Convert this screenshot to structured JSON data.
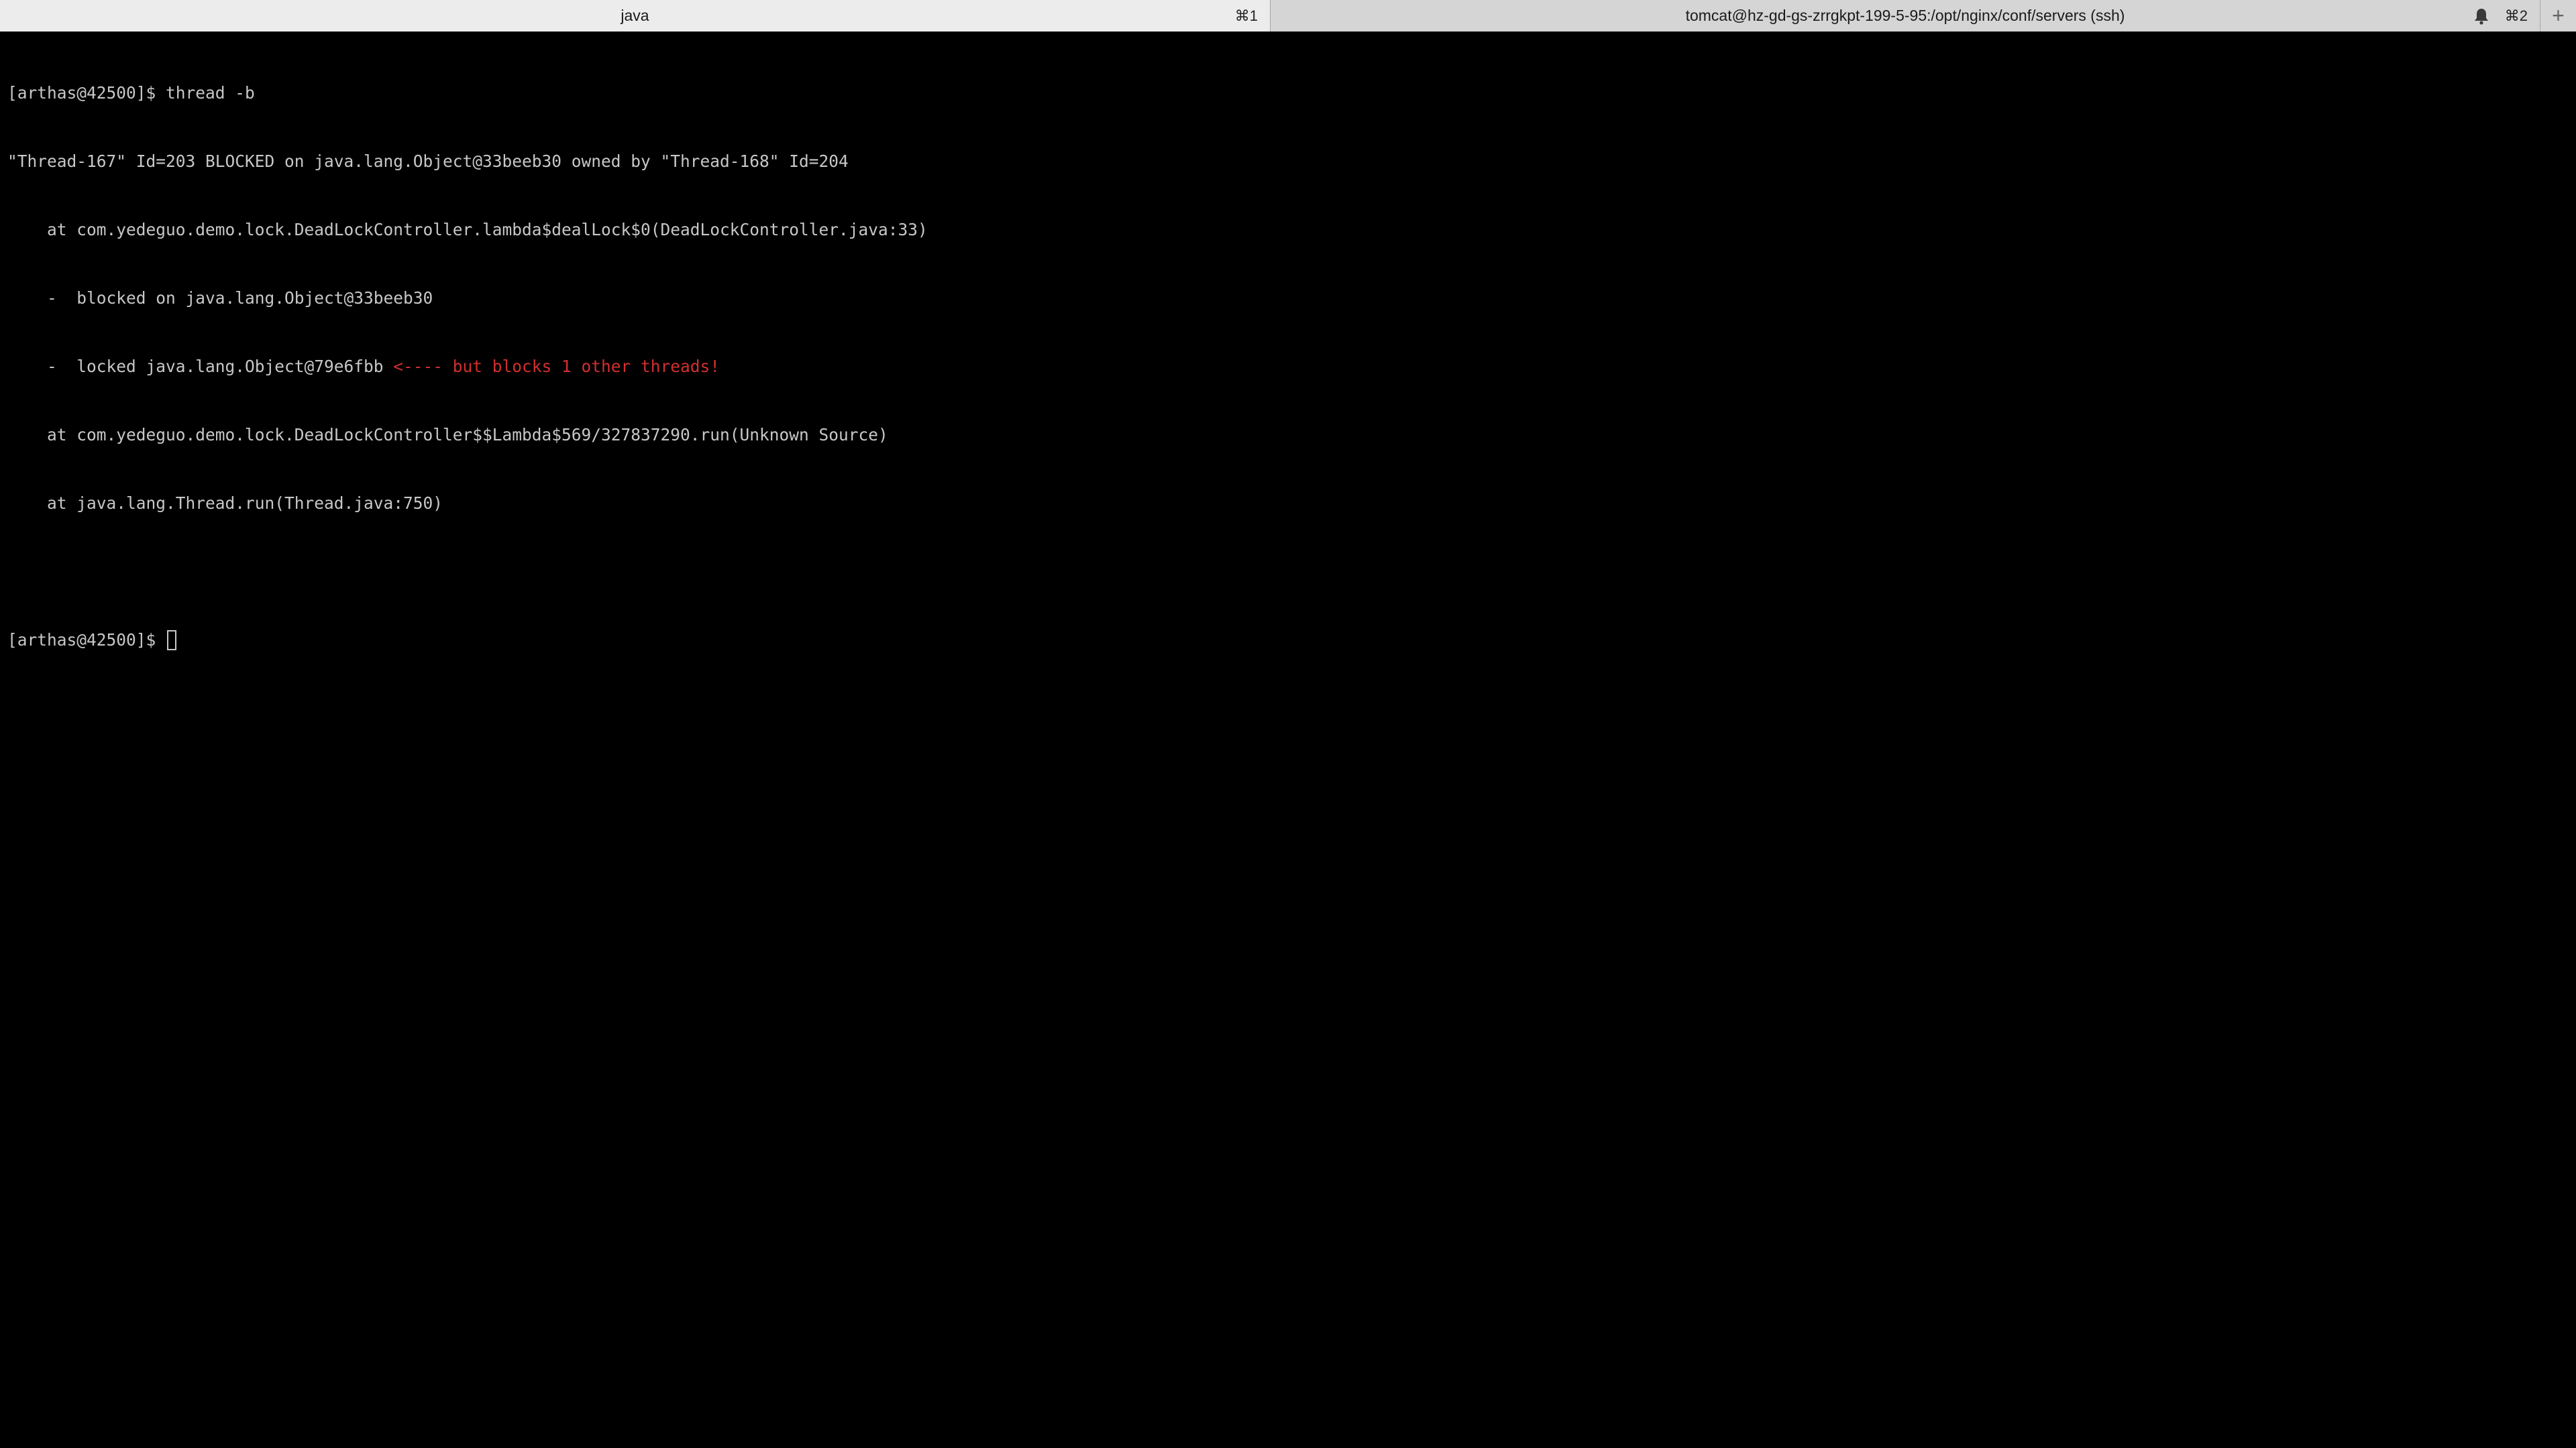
{
  "tabs": [
    {
      "title": "java",
      "shortcut": "⌘1",
      "active": true
    },
    {
      "title": "tomcat@hz-gd-gs-zrrgkpt-199-5-95:/opt/nginx/conf/servers (ssh)",
      "shortcut": "⌘2",
      "active": false
    }
  ],
  "new_tab_label": "+",
  "terminal": {
    "lines": [
      "[arthas@42500]$ thread -b",
      "\"Thread-167\" Id=203 BLOCKED on java.lang.Object@33beeb30 owned by \"Thread-168\" Id=204",
      "    at com.yedeguo.demo.lock.DeadLockController.lambda$dealLock$0(DeadLockController.java:33)",
      "    -  blocked on java.lang.Object@33beeb30",
      "    -  locked java.lang.Object@79e6fbb ",
      "    at com.yedeguo.demo.lock.DeadLockController$$Lambda$569/327837290.run(Unknown Source)",
      "    at java.lang.Thread.run(Thread.java:750)",
      "",
      "[arthas@42500]$ "
    ],
    "highlight": "<---- but blocks 1 other threads!"
  },
  "colors": {
    "background": "#000000",
    "foreground": "#c7c7c7",
    "highlight": "#d12f2f"
  }
}
